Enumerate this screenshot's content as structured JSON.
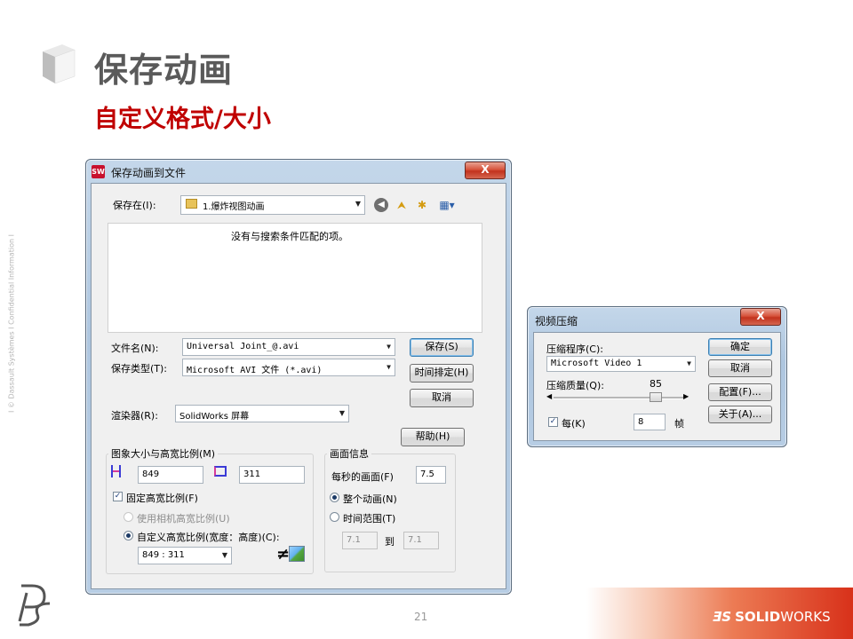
{
  "slide": {
    "title": "保存动画",
    "subtitle": "自定义格式/大小",
    "side_text": "I © Dassault Systèmes I Confidential Information I",
    "page_number": "21",
    "brand_prefix": "SOLID",
    "brand_suffix": "WORKS"
  },
  "save_dialog": {
    "title": "保存动画到文件",
    "close_label": "X",
    "save_in_label": "保存在(I):",
    "save_in_value": "1.爆炸视图动画",
    "empty_message": "没有与搜索条件匹配的项。",
    "filename_label": "文件名(N):",
    "filename_value": "Universal Joint_@.avi",
    "filetype_label": "保存类型(T):",
    "filetype_value": "Microsoft AVI 文件 (*.avi)",
    "save_button": "保存(S)",
    "schedule_button": "时间排定(H)",
    "cancel_button": "取消",
    "renderer_label": "渲染器(R):",
    "renderer_value": "SolidWorks 屏幕",
    "help_button": "帮助(H)",
    "image_group_title": "图象大小与高宽比例(M)",
    "width_value": "849",
    "height_value": "311",
    "fixed_ratio_label": "固定高宽比例(F)",
    "fixed_ratio_checked": true,
    "camera_ratio_label": "使用相机高宽比例(U)",
    "custom_ratio_label": "自定义高宽比例(宽度：高度)(C):",
    "ratio_value": "849 : 311",
    "ne_symbol": "≠",
    "frame_group_title": "画面信息",
    "fps_label": "每秒的画面(F)",
    "fps_value": "7.5",
    "whole_anim_label": "整个动画(N)",
    "time_range_label": "时间范围(T)",
    "range_from": "7.1",
    "range_to_label": "到",
    "range_to": "7.1"
  },
  "compress_dialog": {
    "title": "视频压缩",
    "close_label": "X",
    "compressor_label": "压缩程序(C):",
    "compressor_value": "Microsoft Video 1",
    "quality_label": "压缩质量(Q):",
    "quality_value": "85",
    "keyframe_label": "每(K)",
    "keyframe_checked": true,
    "keyframe_value": "8",
    "frames_unit": "帧",
    "ok_button": "确定",
    "cancel_button": "取消",
    "configure_button": "配置(F)...",
    "about_button": "关于(A)..."
  },
  "colors": {
    "title_gray": "#5a5a5a",
    "subtitle_red": "#c00000",
    "brand_red": "#d8311a",
    "window_frame": "#aec6df"
  }
}
